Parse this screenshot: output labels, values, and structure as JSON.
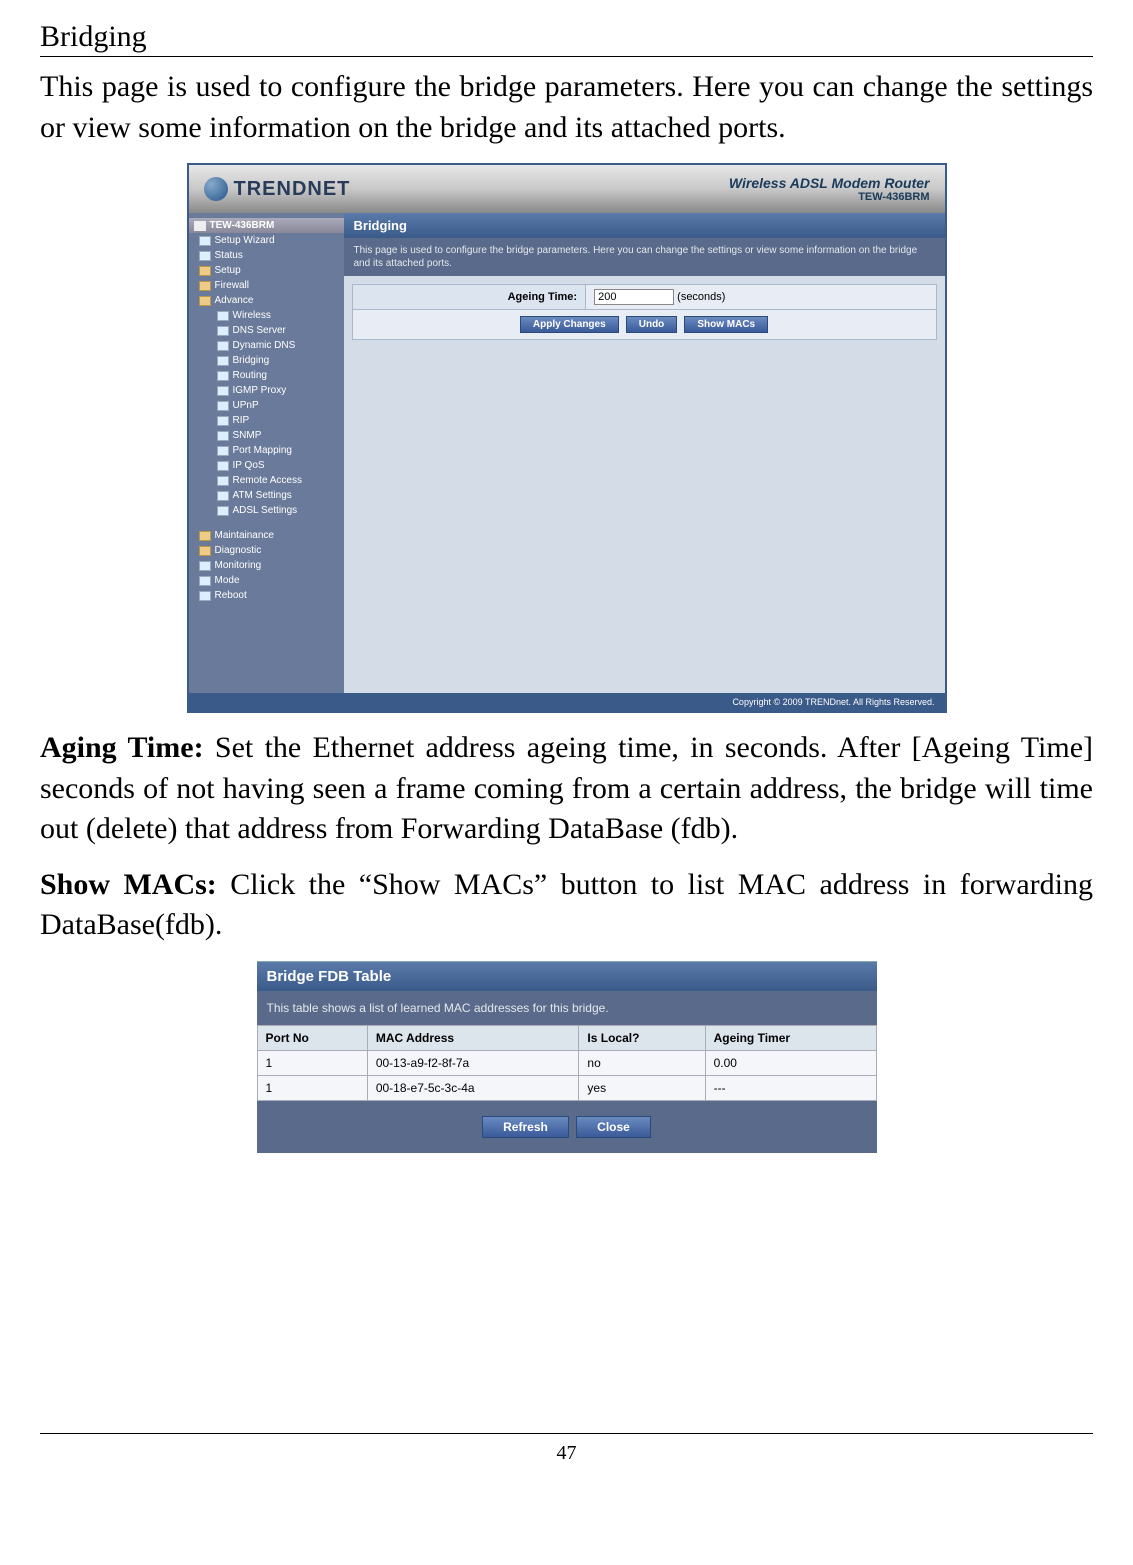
{
  "section": {
    "title": "Bridging"
  },
  "intro": "This page is used to configure the bridge parameters. Here you can change the settings or view some information on the bridge and its attached ports.",
  "screenshot1": {
    "brand": "TRENDNET",
    "product_main": "Wireless ADSL Modem Router",
    "product_model": "TEW-436BRM",
    "nav": {
      "root": "TEW-436BRM",
      "items": [
        "Setup Wizard",
        "Status",
        "Setup",
        "Firewall",
        "Advance",
        "Wireless",
        "DNS Server",
        "Dynamic DNS",
        "Bridging",
        "Routing",
        "IGMP Proxy",
        "UPnP",
        "RIP",
        "SNMP",
        "Port Mapping",
        "IP QoS",
        "Remote Access",
        "ATM Settings",
        "ADSL Settings",
        "Maintainance",
        "Diagnostic",
        "Monitoring",
        "Mode",
        "Reboot"
      ]
    },
    "panel": {
      "title": "Bridging",
      "desc": "This page is used to configure the bridge parameters. Here you can change the settings or view some information on the bridge and its attached ports.",
      "field_label": "Ageing Time:",
      "field_value": "200",
      "field_unit": "(seconds)",
      "btn_apply": "Apply Changes",
      "btn_undo": "Undo",
      "btn_showmacs": "Show MACs"
    },
    "footer": "Copyright © 2009 TRENDnet. All Rights Reserved."
  },
  "para_aging": {
    "label": "Aging Time:",
    "text": " Set the Ethernet address ageing time, in seconds. After [Ageing Time] seconds of not having seen a frame coming from a certain address, the bridge will time out (delete) that address from Forwarding DataBase (fdb)."
  },
  "para_showmacs": {
    "label": "Show MACs:",
    "text": " Click the “Show MACs” button to list MAC address in forwarding DataBase(fdb)."
  },
  "screenshot2": {
    "title": "Bridge FDB Table",
    "desc": "This table shows a list of learned MAC addresses for this bridge.",
    "headers": [
      "Port No",
      "MAC Address",
      "Is Local?",
      "Ageing Timer"
    ],
    "rows": [
      {
        "port": "1",
        "mac": "00-13-a9-f2-8f-7a",
        "local": "no",
        "timer": "0.00"
      },
      {
        "port": "1",
        "mac": "00-18-e7-5c-3c-4a",
        "local": "yes",
        "timer": "---"
      }
    ],
    "btn_refresh": "Refresh",
    "btn_close": "Close"
  },
  "page_number": "47"
}
